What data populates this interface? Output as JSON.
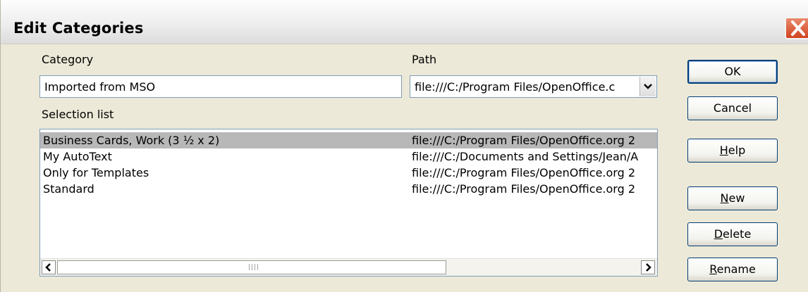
{
  "dialog": {
    "title": "Edit Categories"
  },
  "category": {
    "label": "Category",
    "value": "Imported from MSO"
  },
  "path": {
    "label": "Path",
    "value": "file:///C:/Program Files/OpenOffice.c"
  },
  "selection": {
    "label": "Selection list",
    "rows": [
      {
        "name": "Business Cards, Work (3 ½ x 2)",
        "path": "file:///C:/Program Files/OpenOffice.org 2",
        "selected": true
      },
      {
        "name": "My AutoText",
        "path": "file:///C:/Documents and Settings/Jean/A",
        "selected": false
      },
      {
        "name": "Only for Templates",
        "path": "file:///C:/Program Files/OpenOffice.org 2",
        "selected": false
      },
      {
        "name": "Standard",
        "path": "file:///C:/Program Files/OpenOffice.org 2",
        "selected": false
      }
    ]
  },
  "buttons": {
    "ok": "OK",
    "cancel": "Cancel",
    "help": {
      "mnemonic": "H",
      "rest": "elp"
    },
    "new": {
      "mnemonic": "N",
      "rest": "ew"
    },
    "delete": {
      "mnemonic": "D",
      "rest": "elete"
    },
    "rename": {
      "mnemonic": "R",
      "rest": "ename"
    }
  },
  "icons": [
    "close-icon",
    "chevron-down-icon",
    "scroll-left-icon",
    "scroll-right-icon"
  ]
}
